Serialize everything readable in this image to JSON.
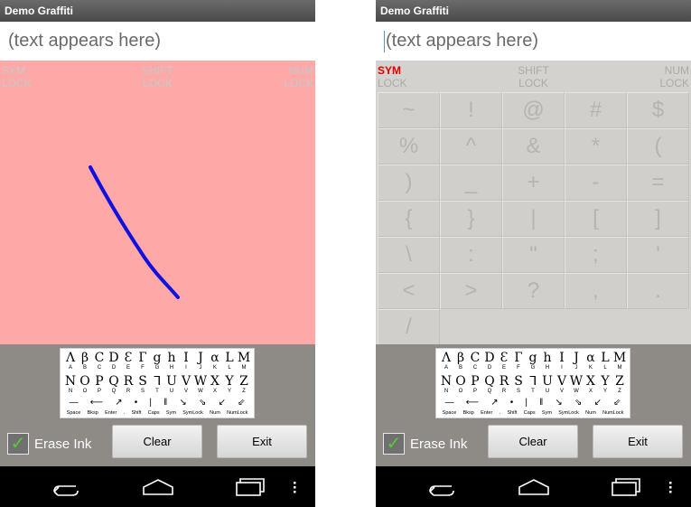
{
  "app": {
    "title": "Demo Graffiti"
  },
  "text_field": {
    "placeholder": "(text appears here)"
  },
  "mode_labels": {
    "sym": [
      "SYM",
      "LOCK"
    ],
    "shift": [
      "SHIFT",
      "LOCK"
    ],
    "num": [
      "NUM",
      "LOCK"
    ]
  },
  "symbols": [
    [
      "~",
      "!",
      "@",
      "#",
      "$"
    ],
    [
      "%",
      "^",
      "&",
      "*",
      "("
    ],
    [
      ")",
      "_",
      "+",
      "-",
      "="
    ],
    [
      "{",
      "}",
      "|",
      "[",
      "]"
    ],
    [
      "\\",
      ":",
      "\"",
      ";",
      "'"
    ],
    [
      "<",
      ">",
      "?",
      ",",
      "."
    ],
    [
      "/"
    ]
  ],
  "reference_card": {
    "glyph_row1": [
      "Λ",
      "β",
      "C",
      "D",
      "Ɛ",
      "Г",
      "g",
      "h",
      "I",
      "J",
      "α",
      "L",
      "M"
    ],
    "letters_row1": [
      "A",
      "B",
      "C",
      "D",
      "E",
      "F",
      "G",
      "H",
      "I",
      "J",
      "K",
      "L",
      "M"
    ],
    "glyph_row2": [
      "N",
      "O",
      "P",
      "Q",
      "R",
      "S",
      "ᒣ",
      "U",
      "V",
      "W",
      "X",
      "Y",
      "Z"
    ],
    "letters_row2": [
      "N",
      "O",
      "P",
      "Q",
      "R",
      "S",
      "T",
      "U",
      "V",
      "W",
      "X",
      "Y",
      "Z"
    ],
    "command_arrows": [
      "—",
      "⟵",
      "↗",
      "•",
      "|",
      "‖",
      "↘",
      "⇘",
      "↙",
      "⇙"
    ],
    "commands": [
      "Space",
      "Bksp",
      "Enter",
      ".",
      "Shift",
      "Caps",
      "Sym",
      "SymLock",
      "Num",
      "NumLock"
    ]
  },
  "controls": {
    "erase_ink_label": "Erase Ink",
    "erase_ink_checked": true,
    "clear_label": "Clear",
    "exit_label": "Exit"
  },
  "colors": {
    "ink_background": "#ffa8a8",
    "ink_stroke": "#1010e0",
    "active_mode": "#e00000",
    "panel_background": "#8e8b87"
  },
  "icons": [
    "back-icon",
    "home-icon",
    "recent-apps-icon",
    "overflow-menu-icon",
    "checkmark-icon"
  ]
}
